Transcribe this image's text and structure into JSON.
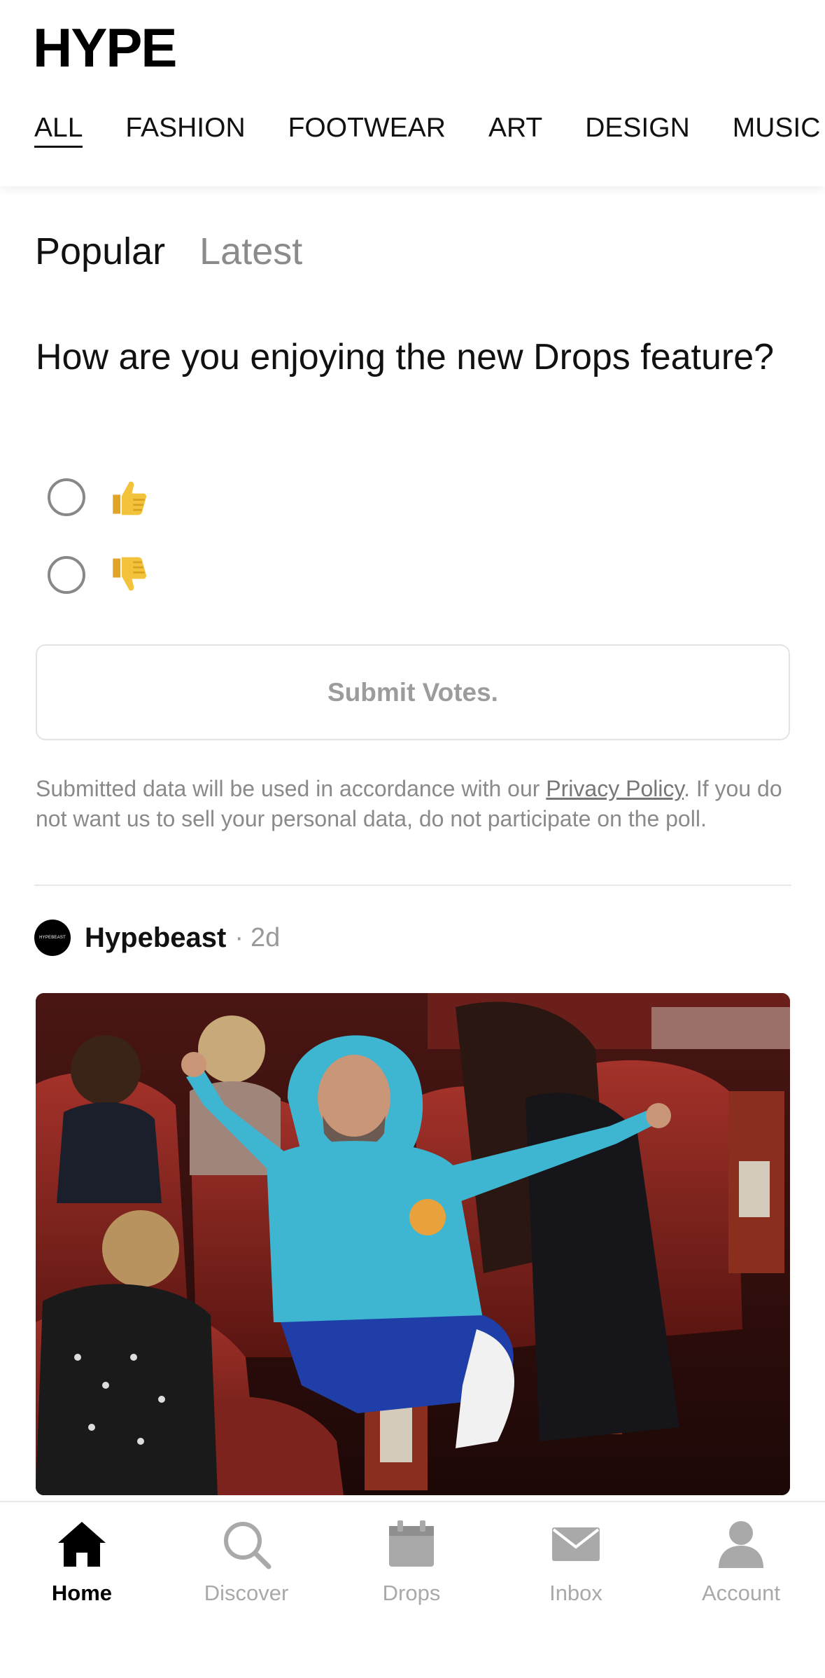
{
  "app": {
    "logo_text": "HYPE"
  },
  "categories": [
    "ALL",
    "FASHION",
    "FOOTWEAR",
    "ART",
    "DESIGN",
    "MUSIC"
  ],
  "feed_tabs": {
    "popular": "Popular",
    "latest": "Latest"
  },
  "poll": {
    "question": "How are you enjoying the new Drops feature?",
    "options": [
      "thumbs-up",
      "thumbs-down"
    ],
    "submit_label": "Submit Votes.",
    "disclaimer_before": "Submitted data will be used in accordance with our ",
    "disclaimer_link": "Privacy Policy",
    "disclaimer_after": ". If you do not want us to sell your personal data, do not participate on the poll."
  },
  "post": {
    "avatar_text": "HYPEBEAST",
    "author": "Hypebeast",
    "separator": "·",
    "age": "2d"
  },
  "bottom_nav": {
    "home": "Home",
    "discover": "Discover",
    "drops": "Drops",
    "inbox": "Inbox",
    "account": "Account"
  },
  "colors": {
    "active_nav": "#000000",
    "inactive_nav": "#a9a9a9",
    "hoodie": "#3fb6d1",
    "emoji": "#f4c33d"
  }
}
